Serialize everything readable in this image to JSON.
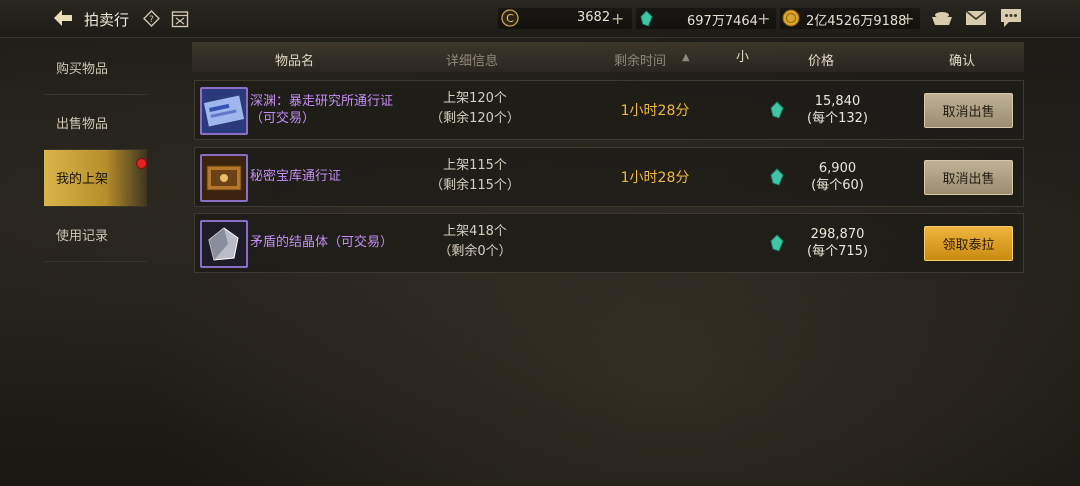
{
  "header": {
    "title": "拍卖行",
    "currencies": [
      {
        "icon": "coin-c-icon",
        "value": "3682"
      },
      {
        "icon": "green-gem-icon",
        "value": "697万7464"
      },
      {
        "icon": "gold-coin-icon",
        "value": "2亿4526万9188"
      }
    ]
  },
  "sidebar": {
    "items": [
      {
        "label": "购买物品"
      },
      {
        "label": "出售物品"
      },
      {
        "label": "我的上架"
      },
      {
        "label": "使用记录"
      }
    ]
  },
  "table": {
    "columns": [
      "物品名",
      "详细信息",
      "剩余时间",
      "小",
      "价格",
      "确认"
    ],
    "sort_indicator": "▲",
    "rows": [
      {
        "name": "深渊：暴走研究所通行证（可交易）",
        "listed": "上架120个",
        "remaining": "（剩余120个）",
        "time": "1小时28分",
        "total": "15,840",
        "each": "(每个132)",
        "action": "取消出售"
      },
      {
        "name": "秘密宝库通行证",
        "listed": "上架115个",
        "remaining": "（剩余115个）",
        "time": "1小时28分",
        "total": "6,900",
        "each": "(每个60)",
        "action": "取消出售"
      },
      {
        "name": "矛盾的结晶体（可交易）",
        "listed": "上架418个",
        "remaining": "（剩余0个）",
        "time": "",
        "total": "298,870",
        "each": "(每个715)",
        "action": "领取泰拉"
      }
    ]
  },
  "colors": {
    "accent_gold": "#d9b64a",
    "time_orange": "#f0b93a",
    "item_purple": "#c38ef2"
  }
}
